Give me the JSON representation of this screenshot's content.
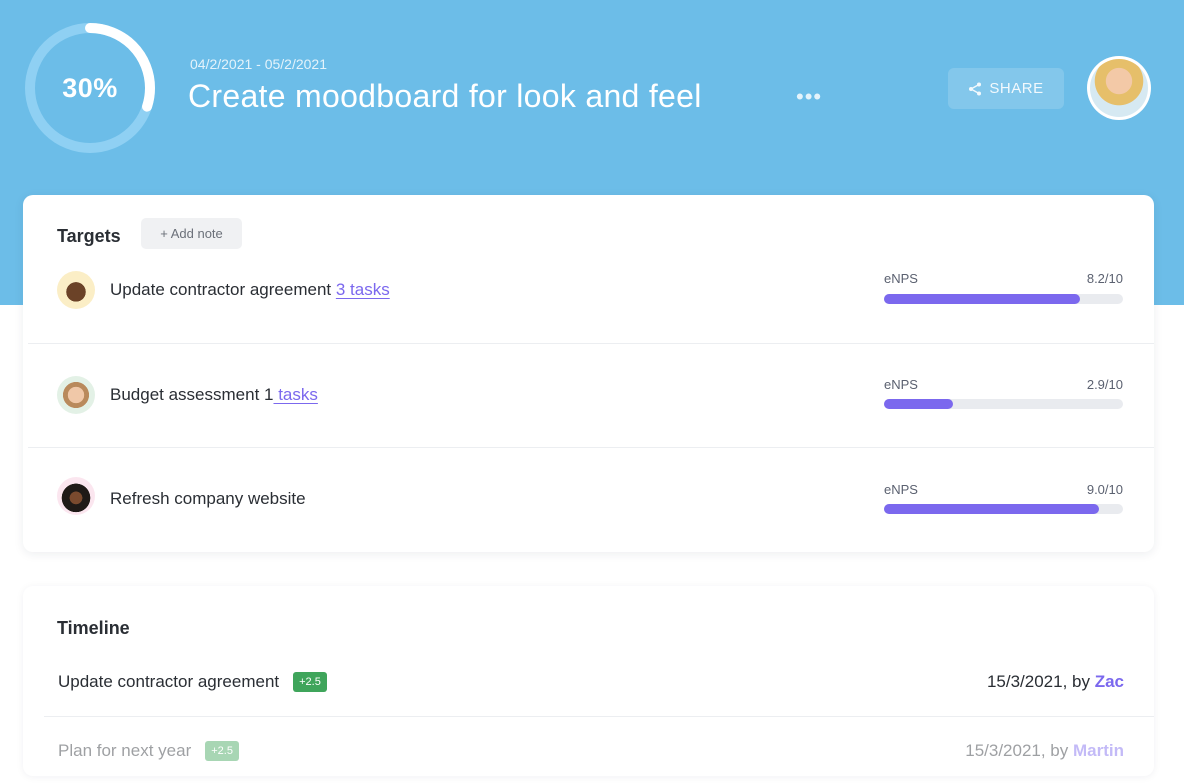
{
  "header": {
    "progress": {
      "percent_label": "30%",
      "value": 0.3
    },
    "date_range": "04/2/2021 - 05/2/2021",
    "title": "Create moodboard for look and feel",
    "more_label": "•••",
    "share_label": "SHARE",
    "avatar_icon": "user-avatar-icon"
  },
  "targets": {
    "title": "Targets",
    "add_note_label": "+ Add note",
    "rows": [
      {
        "label": "Update contractor agreement",
        "tasks_link": "3 tasks",
        "metric_label": "eNPS",
        "metric_value": "8.2/10",
        "score": 8.2
      },
      {
        "label": "Budget assessment 1",
        "tasks_link": " tasks",
        "metric_label": "eNPS",
        "metric_value": "2.9/10",
        "score": 2.9
      },
      {
        "label": "Refresh company website",
        "tasks_link": "",
        "metric_label": "eNPS",
        "metric_value": "9.0/10",
        "score": 9.0
      }
    ]
  },
  "timeline": {
    "title": "Timeline",
    "rows": [
      {
        "label": "Update contractor agreement",
        "badge": "+2.5",
        "date": "15/3/2021, by",
        "author": "Zac"
      },
      {
        "label": "Plan for next year",
        "badge": "+2.5",
        "date": "15/3/2021, by",
        "author": "Martin"
      }
    ]
  },
  "colors": {
    "hero_bg": "#6cbde8",
    "accent": "#7b68ee",
    "badge_green": "#3fa55b"
  }
}
